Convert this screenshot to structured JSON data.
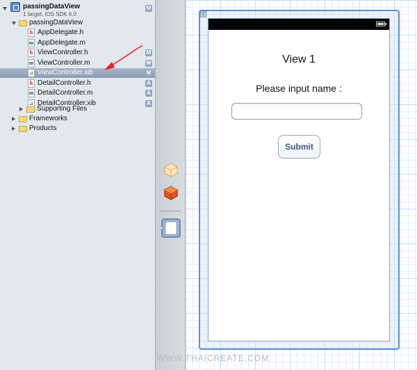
{
  "project": {
    "name": "passingDataView",
    "subtitle": "1 target, iOS SDK 6.0",
    "badge": "M"
  },
  "navigator": {
    "group_name": "passingDataView",
    "files": [
      {
        "name": "AppDelegate.h",
        "kind": "h",
        "badge": ""
      },
      {
        "name": "AppDelegate.m",
        "kind": "m",
        "badge": ""
      },
      {
        "name": "ViewController.h",
        "kind": "h",
        "badge": "M"
      },
      {
        "name": "ViewController.m",
        "kind": "m",
        "badge": "M"
      },
      {
        "name": "ViewController.xib",
        "kind": "xib",
        "badge": "M"
      },
      {
        "name": "DetailController.h",
        "kind": "h",
        "badge": "A"
      },
      {
        "name": "DetailController.m",
        "kind": "m",
        "badge": "A"
      },
      {
        "name": "DetailController.xib",
        "kind": "xib",
        "badge": "A"
      }
    ],
    "supporting_files": "Supporting Files",
    "frameworks": "Frameworks",
    "products": "Products",
    "selected": "ViewController.xib"
  },
  "file_icons": {
    "h": "h",
    "m": "m",
    "xib": "⊿"
  },
  "view": {
    "title": "View 1",
    "input_label": "Please input name :",
    "input_value": "",
    "submit_label": "Submit",
    "close_glyph": "x"
  },
  "watermark": "WWW.THAICREATE.COM",
  "icons": {
    "dock": [
      "placeholder-cube-icon",
      "first-responder-cube-icon",
      "view-object-icon"
    ],
    "arrow": "red-arrow-icon"
  },
  "colors": {
    "selection": "#8b9bb2",
    "frame_accent": "#5d8fd6",
    "arrow": "#e8202a",
    "button_text": "#3b5580"
  }
}
